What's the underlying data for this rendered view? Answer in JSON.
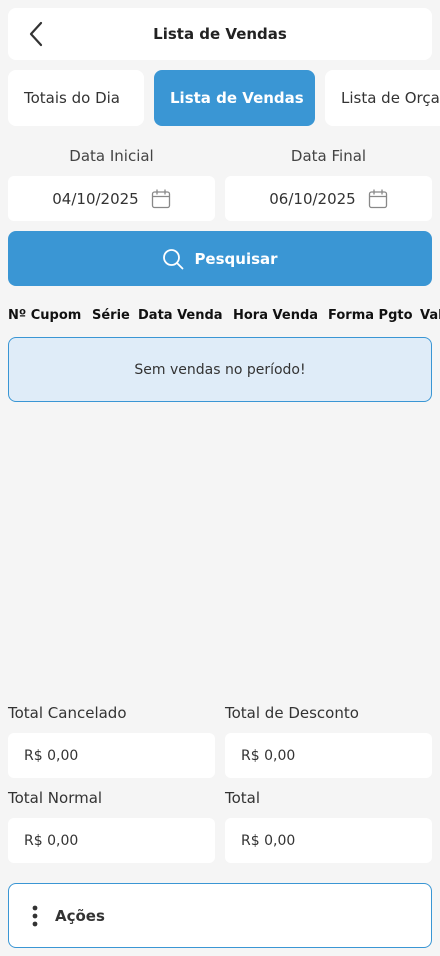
{
  "header": {
    "title": "Lista de Vendas"
  },
  "tabs": [
    {
      "label": "Totais do Dia",
      "active": false
    },
    {
      "label": "Lista de Vendas",
      "active": true
    },
    {
      "label": "Lista de Orçamentos",
      "active": false
    }
  ],
  "filters": {
    "start_label": "Data Inicial",
    "start_value": "04/10/2025",
    "end_label": "Data Final",
    "end_value": "06/10/2025"
  },
  "search": {
    "label": "Pesquisar"
  },
  "table": {
    "columns": [
      "Nº Cupom",
      "Série",
      "Data Venda",
      "Hora Venda",
      "Forma Pgto",
      "Valor"
    ],
    "empty_message": "Sem vendas no período!"
  },
  "totals": {
    "cancelado_label": "Total Cancelado",
    "cancelado_value": "R$ 0,00",
    "desconto_label": "Total de Desconto",
    "desconto_value": "R$ 0,00",
    "normal_label": "Total Normal",
    "normal_value": "R$ 0,00",
    "total_label": "Total",
    "total_value": "R$ 0,00"
  },
  "actions": {
    "label": "Ações"
  },
  "colors": {
    "accent": "#3a96d4",
    "empty_bg": "#dfecf8",
    "background": "#f5f5f5"
  }
}
